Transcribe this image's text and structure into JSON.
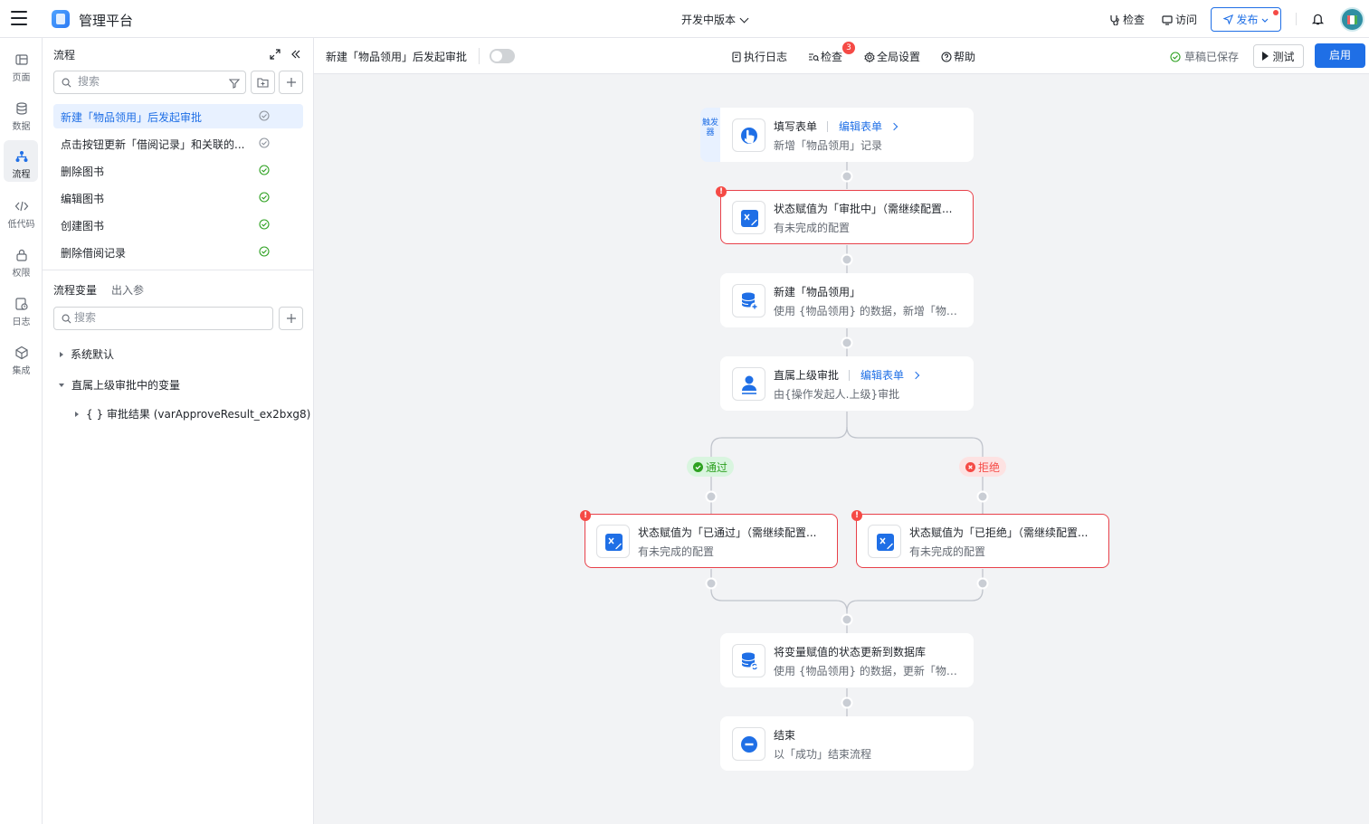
{
  "header": {
    "app_title": "管理平台",
    "version": "开发中版本",
    "inspect": "检查",
    "visit": "访问",
    "publish": "发布"
  },
  "rail": [
    {
      "label": "页面",
      "icon": "page-icon"
    },
    {
      "label": "数据",
      "icon": "database-icon"
    },
    {
      "label": "流程",
      "icon": "flow-icon"
    },
    {
      "label": "低代码",
      "icon": "code-icon"
    },
    {
      "label": "权限",
      "icon": "lock-icon"
    },
    {
      "label": "日志",
      "icon": "log-icon"
    },
    {
      "label": "集成",
      "icon": "integration-icon"
    }
  ],
  "panel": {
    "title": "流程",
    "search_placeholder": "搜索",
    "flows": [
      {
        "name": "新建「物品领用」后发起审批",
        "status": "draft"
      },
      {
        "name": "点击按钮更新「借阅记录」和关联的...",
        "status": "draft"
      },
      {
        "name": "删除图书",
        "status": "enabled"
      },
      {
        "name": "编辑图书",
        "status": "enabled"
      },
      {
        "name": "创建图书",
        "status": "enabled"
      },
      {
        "name": "删除借阅记录",
        "status": "enabled"
      }
    ],
    "tab_vars": "流程变量",
    "tab_params": "出入参",
    "var_search_placeholder": "搜索",
    "tree": {
      "system": "系统默认",
      "approval": "直属上级审批中的变量",
      "result": "{ } 审批结果 (varApproveResult_ex2bxg8)"
    }
  },
  "canvas_header": {
    "flow_name": "新建「物品领用」后发起审批",
    "exec_log": "执行日志",
    "check": "检查",
    "check_count": "3",
    "global_settings": "全局设置",
    "help": "帮助",
    "saved": "草稿已保存",
    "test": "测试",
    "enable": "启用"
  },
  "canvas": {
    "trigger_tag": "触发器",
    "nodes": {
      "fill_form": {
        "title": "填写表单",
        "edit": "编辑表单",
        "desc": "新增「物品领用」记录"
      },
      "set_pending": {
        "title": "状态赋值为「审批中」（需继续配置...",
        "desc": "有未完成的配置"
      },
      "create_item": {
        "title": "新建「物品领用」",
        "desc": "使用 {物品领用} 的数据，新增「物品..."
      },
      "approval": {
        "title": "直属上级审批",
        "edit": "编辑表单",
        "desc": "由{操作发起人.上级}审批"
      },
      "set_passed": {
        "title": "状态赋值为「已通过」（需继续配置...",
        "desc": "有未完成的配置"
      },
      "set_rejected": {
        "title": "状态赋值为「已拒绝」（需继续配置...",
        "desc": "有未完成的配置"
      },
      "update_db": {
        "title": "将变量赋值的状态更新到数据库",
        "desc": "使用 {物品领用} 的数据，更新「物品..."
      },
      "end": {
        "title": "结束",
        "desc": "以「成功」结束流程"
      }
    },
    "branch_pass": "通过",
    "branch_reject": "拒绝",
    "error_mark": "!"
  },
  "colors": {
    "accent": "#1f6fe6",
    "success": "#2ea121",
    "error": "#f54a45"
  }
}
